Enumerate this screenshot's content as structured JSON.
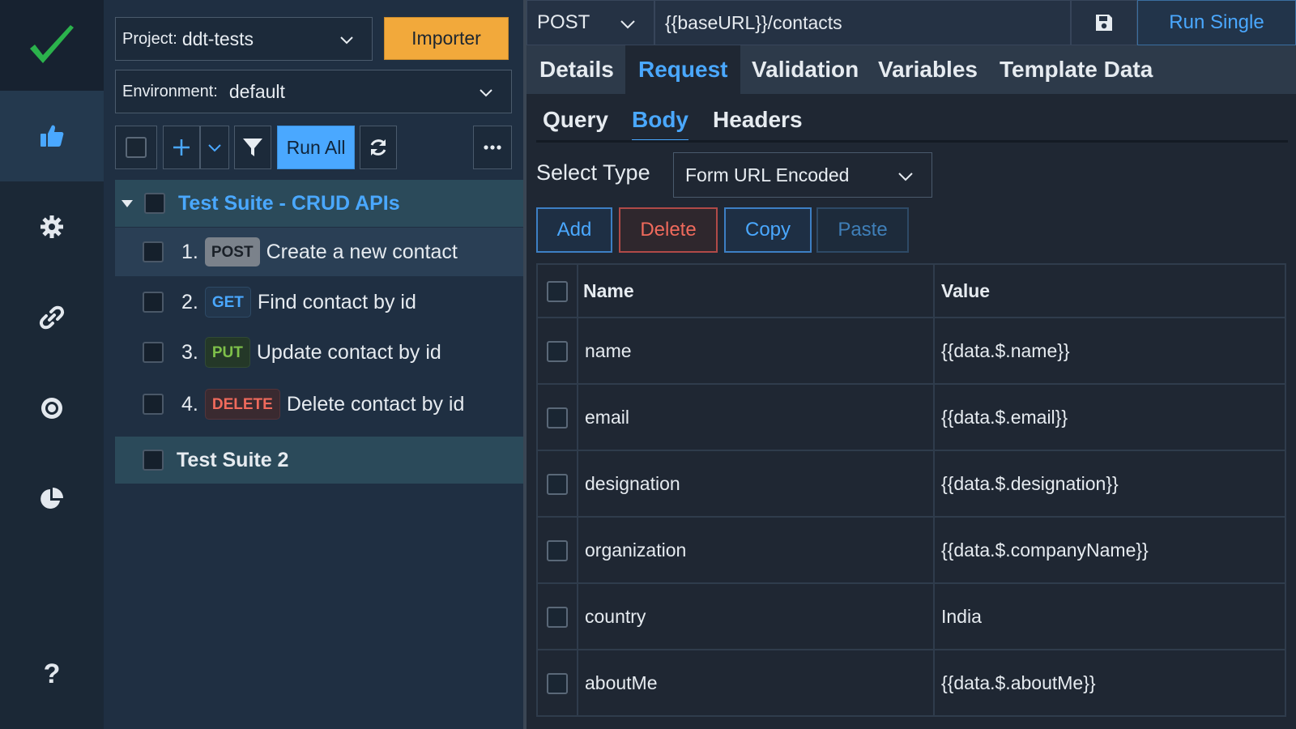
{
  "colors": {
    "accent": "#4aa8ff",
    "importer": "#f2a93b",
    "check": "#2bb24c",
    "danger": "#f06a5c"
  },
  "rail": {
    "items": [
      "thumbs-up-icon",
      "gear-icon",
      "link-icon",
      "target-icon",
      "pie-chart-icon"
    ],
    "help": "?"
  },
  "tree": {
    "project_label": "Project:",
    "project_value": "ddt-tests",
    "importer": "Importer",
    "environment_label": "Environment:",
    "environment_value": "default",
    "run_all": "Run All",
    "suites": [
      {
        "title": "Test Suite - CRUD APIs",
        "cases": [
          {
            "num": "1.",
            "method": "POST",
            "name": "Create a new contact"
          },
          {
            "num": "2.",
            "method": "GET",
            "name": "Find contact by id"
          },
          {
            "num": "3.",
            "method": "PUT",
            "name": "Update contact by id"
          },
          {
            "num": "4.",
            "method": "DELETE",
            "name": "Delete contact by id"
          }
        ]
      },
      {
        "title": "Test Suite 2"
      }
    ]
  },
  "request": {
    "method": "POST",
    "url": "{{baseURL}}/contacts",
    "run_single": "Run Single",
    "tabs": [
      "Details",
      "Request",
      "Validation",
      "Variables",
      "Template Data"
    ],
    "subtabs": [
      "Query",
      "Body",
      "Headers"
    ],
    "select_type_label": "Select Type",
    "select_type_value": "Form URL Encoded",
    "buttons": {
      "add": "Add",
      "delete": "Delete",
      "copy": "Copy",
      "paste": "Paste"
    },
    "table": {
      "headers": [
        "Name",
        "Value"
      ],
      "rows": [
        {
          "name": "name",
          "value": "{{data.$.name}}"
        },
        {
          "name": "email",
          "value": "{{data.$.email}}"
        },
        {
          "name": "designation",
          "value": "{{data.$.designation}}"
        },
        {
          "name": "organization",
          "value": "{{data.$.companyName}}"
        },
        {
          "name": "country",
          "value": "India"
        },
        {
          "name": "aboutMe",
          "value": "{{data.$.aboutMe}}"
        }
      ]
    }
  }
}
